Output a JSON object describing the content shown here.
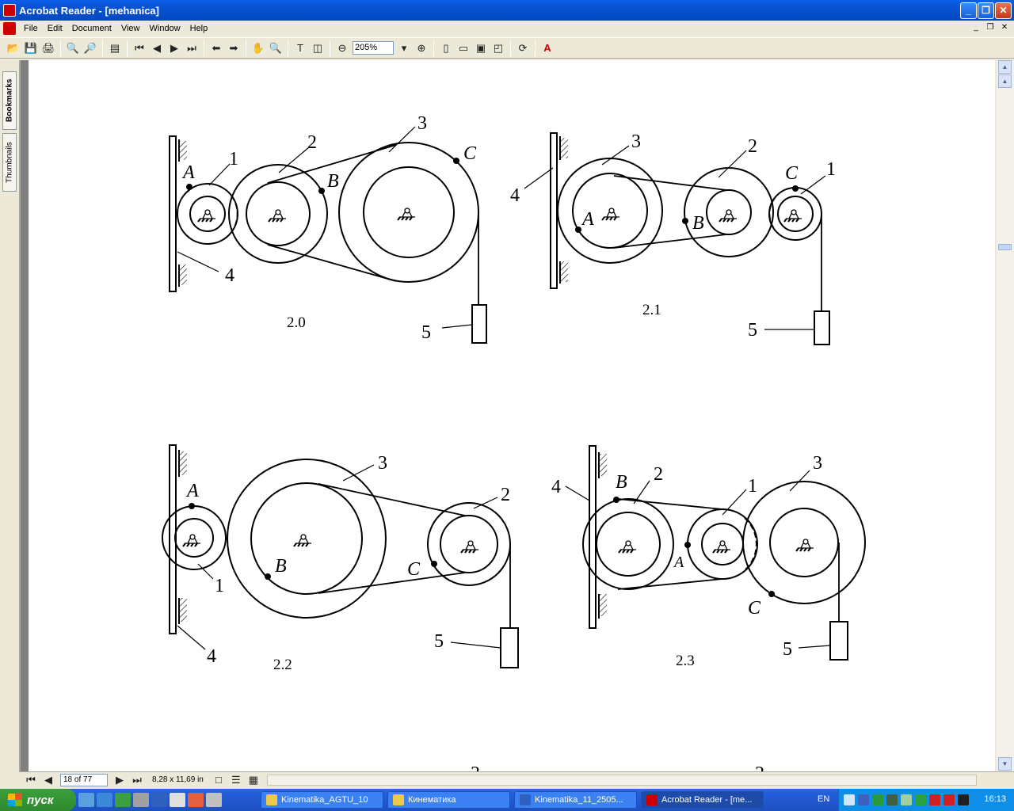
{
  "window": {
    "title": "Acrobat Reader - [mehanica]",
    "controls": [
      "_",
      "❐",
      "✕"
    ]
  },
  "menu": {
    "items": [
      "File",
      "Edit",
      "Document",
      "View",
      "Window",
      "Help"
    ]
  },
  "toolbar": {
    "zoom": "205%"
  },
  "nav_tabs": {
    "bookmarks": "Bookmarks",
    "thumbnails": "Thumbnails"
  },
  "status": {
    "page": "18 of 77",
    "page_size": "8,28 x 11,69 in"
  },
  "figures": {
    "captions": [
      "2.0",
      "2.1",
      "2.2",
      "2.3"
    ],
    "numbers": [
      "1",
      "2",
      "3",
      "4",
      "5"
    ],
    "points": [
      "A",
      "B",
      "C"
    ],
    "next_page_partial": [
      "3",
      "2"
    ]
  },
  "taskbar": {
    "start_label": "пуск",
    "tasks": [
      "Kinematika_AGTU_10",
      "Кинематика",
      "Kinematika_11_2505...",
      "Acrobat Reader - [me..."
    ],
    "lang": "EN",
    "clock": "16:13"
  },
  "colors": {
    "titlebar": "#0852d0",
    "taskbar": "#245edb",
    "start": "#2f8a2f"
  }
}
